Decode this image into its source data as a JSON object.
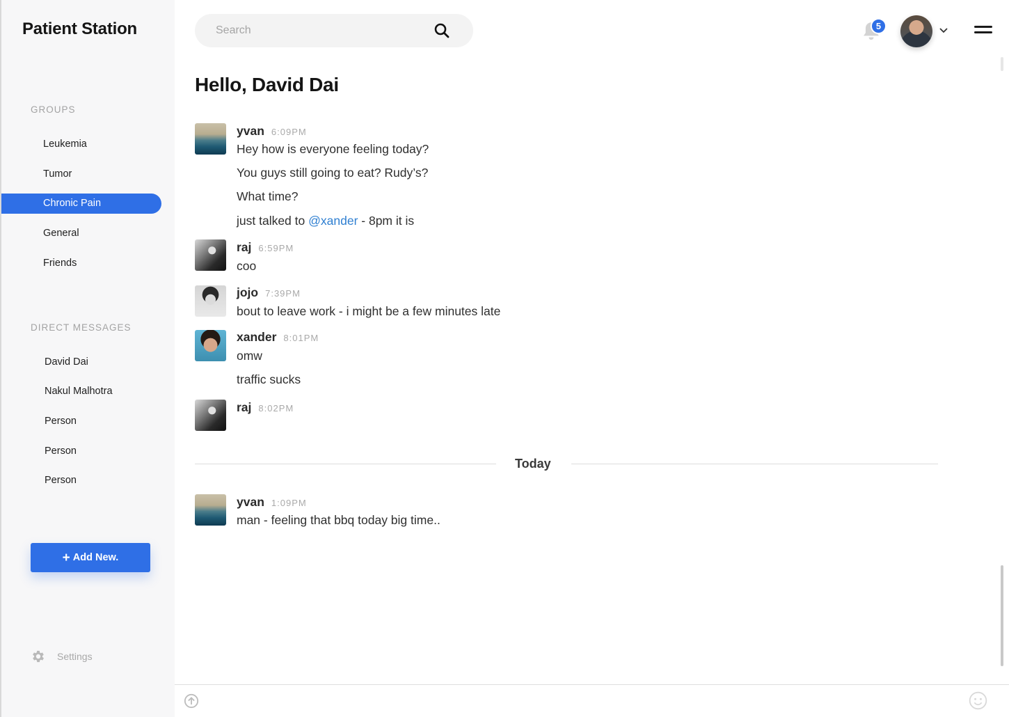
{
  "app": {
    "title": "Patient Station"
  },
  "sidebar": {
    "groups_label": "GROUPS",
    "groups": [
      {
        "label": "Leukemia",
        "active": false
      },
      {
        "label": "Tumor",
        "active": false
      },
      {
        "label": "Chronic Pain",
        "active": true
      },
      {
        "label": "General",
        "active": false
      },
      {
        "label": "Friends",
        "active": false
      }
    ],
    "dm_label": "DIRECT MESSAGES",
    "direct_messages": [
      {
        "label": "David Dai"
      },
      {
        "label": "Nakul Malhotra"
      },
      {
        "label": "Person"
      },
      {
        "label": "Person"
      },
      {
        "label": "Person"
      }
    ],
    "add_new_label": "Add New.",
    "settings_label": "Settings"
  },
  "header": {
    "search_placeholder": "Search",
    "notification_count": "5",
    "greeting": "Hello, David Dai"
  },
  "messages": [
    {
      "user": "yvan",
      "time": "6:09PM",
      "lines": [
        "Hey how is everyone feeling today?",
        "You guys still going to eat? Rudy’s?",
        "What time?"
      ],
      "mention_line": {
        "before": "just talked to ",
        "mention": "@xander",
        "after": " - 8pm it is"
      }
    },
    {
      "user": "raj",
      "time": "6:59PM",
      "lines": [
        "coo"
      ]
    },
    {
      "user": "jojo",
      "time": "7:39PM",
      "lines": [
        "bout to leave work - i might be a few minutes late"
      ]
    },
    {
      "user": "xander",
      "time": "8:01PM",
      "lines": [
        "omw",
        "traffic sucks"
      ]
    },
    {
      "user": "raj",
      "time": "8:02PM",
      "lines": []
    }
  ],
  "divider_label": "Today",
  "today_messages": [
    {
      "user": "yvan",
      "time": "1:09PM",
      "lines": [
        "man - feeling that bbq today big time.."
      ]
    }
  ],
  "colors": {
    "accent": "#2f6fe6",
    "mention": "#2f7fd1",
    "sidebar_bg": "#f7f7f8"
  }
}
